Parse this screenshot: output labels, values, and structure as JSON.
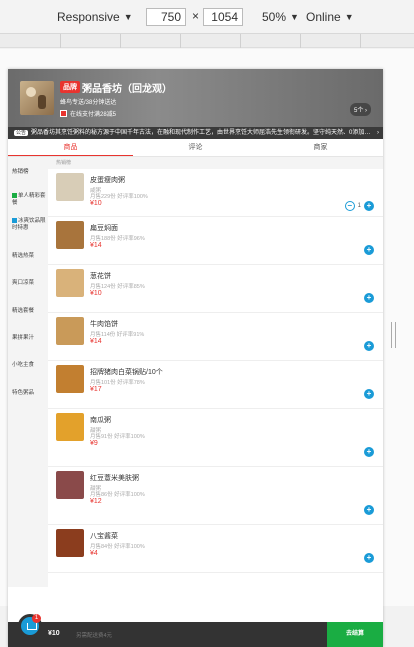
{
  "devtools": {
    "device_mode": "Responsive",
    "width": "750",
    "height": "1054",
    "zoom": "50%",
    "network": "Online"
  },
  "header": {
    "brand_badge": "品牌",
    "shop_name": "粥品香坊（回龙观）",
    "subtitle": "蜂鸟专送/38分钟送达",
    "pay_text": "在线支付满28减5",
    "coupon_text": "5个 ›",
    "notice_tag": "公告",
    "notice_text": "粥品香坊其烹饪粥料的秘方源于中国千年古法，在融和现代制作工艺，由世界烹饪大师屈浩先生领衔研发。坚守纯天然、0添加…"
  },
  "tabs": [
    {
      "label": "商品",
      "active": true
    },
    {
      "label": "评论",
      "active": false
    },
    {
      "label": "商家",
      "active": false
    }
  ],
  "sidebar": [
    {
      "label": "热销榜",
      "icon": ""
    },
    {
      "label": "单人精彩套餐",
      "icon": "discount-icon",
      "icon_color": "#1aad43"
    },
    {
      "label": "冰爽饮品限时特惠",
      "icon": "special-icon",
      "icon_color": "#1a9bd7"
    },
    {
      "label": "精选热菜",
      "icon": ""
    },
    {
      "label": "爽口凉菜",
      "icon": ""
    },
    {
      "label": "精选套餐",
      "icon": ""
    },
    {
      "label": "果拼果汁",
      "icon": ""
    },
    {
      "label": "小吃主食",
      "icon": ""
    },
    {
      "label": "特色粥品",
      "icon": ""
    }
  ],
  "section_title": "热销榜",
  "products": [
    {
      "name": "皮蛋瘦肉粥",
      "desc": "咸粥",
      "sales": "月售229份  好评率100%",
      "price": "¥10",
      "qty": "1",
      "thumb": "#d8cdb7"
    },
    {
      "name": "扁豆焖面",
      "desc": "",
      "sales": "月售188份  好评率96%",
      "price": "¥14",
      "qty": "",
      "thumb": "#a8743c"
    },
    {
      "name": "葱花饼",
      "desc": "",
      "sales": "月售124份  好评率85%",
      "price": "¥10",
      "qty": "",
      "thumb": "#d9b27a"
    },
    {
      "name": "牛肉馅饼",
      "desc": "",
      "sales": "月售114份  好评率91%",
      "price": "¥14",
      "qty": "",
      "thumb": "#c99a59"
    },
    {
      "name": "招牌猪肉白菜锅贴/10个",
      "desc": "",
      "sales": "月售101份  好评率78%",
      "price": "¥17",
      "qty": "",
      "thumb": "#c27f30"
    },
    {
      "name": "南瓜粥",
      "desc": "甜粥",
      "sales": "月售91份  好评率100%",
      "price": "¥9",
      "qty": "",
      "thumb": "#e3a12b"
    },
    {
      "name": "红豆薏米美肤粥",
      "desc": "甜粥",
      "sales": "月售86份  好评率100%",
      "price": "¥12",
      "qty": "",
      "thumb": "#8a4a4a"
    },
    {
      "name": "八宝酱菜",
      "desc": "",
      "sales": "月售84份  好评率100%",
      "price": "¥4",
      "qty": "",
      "thumb": "#8b3d1e"
    }
  ],
  "cart": {
    "badge": "1",
    "total": "¥10",
    "note": "另需配送费4元",
    "checkout_label": "去结算"
  }
}
